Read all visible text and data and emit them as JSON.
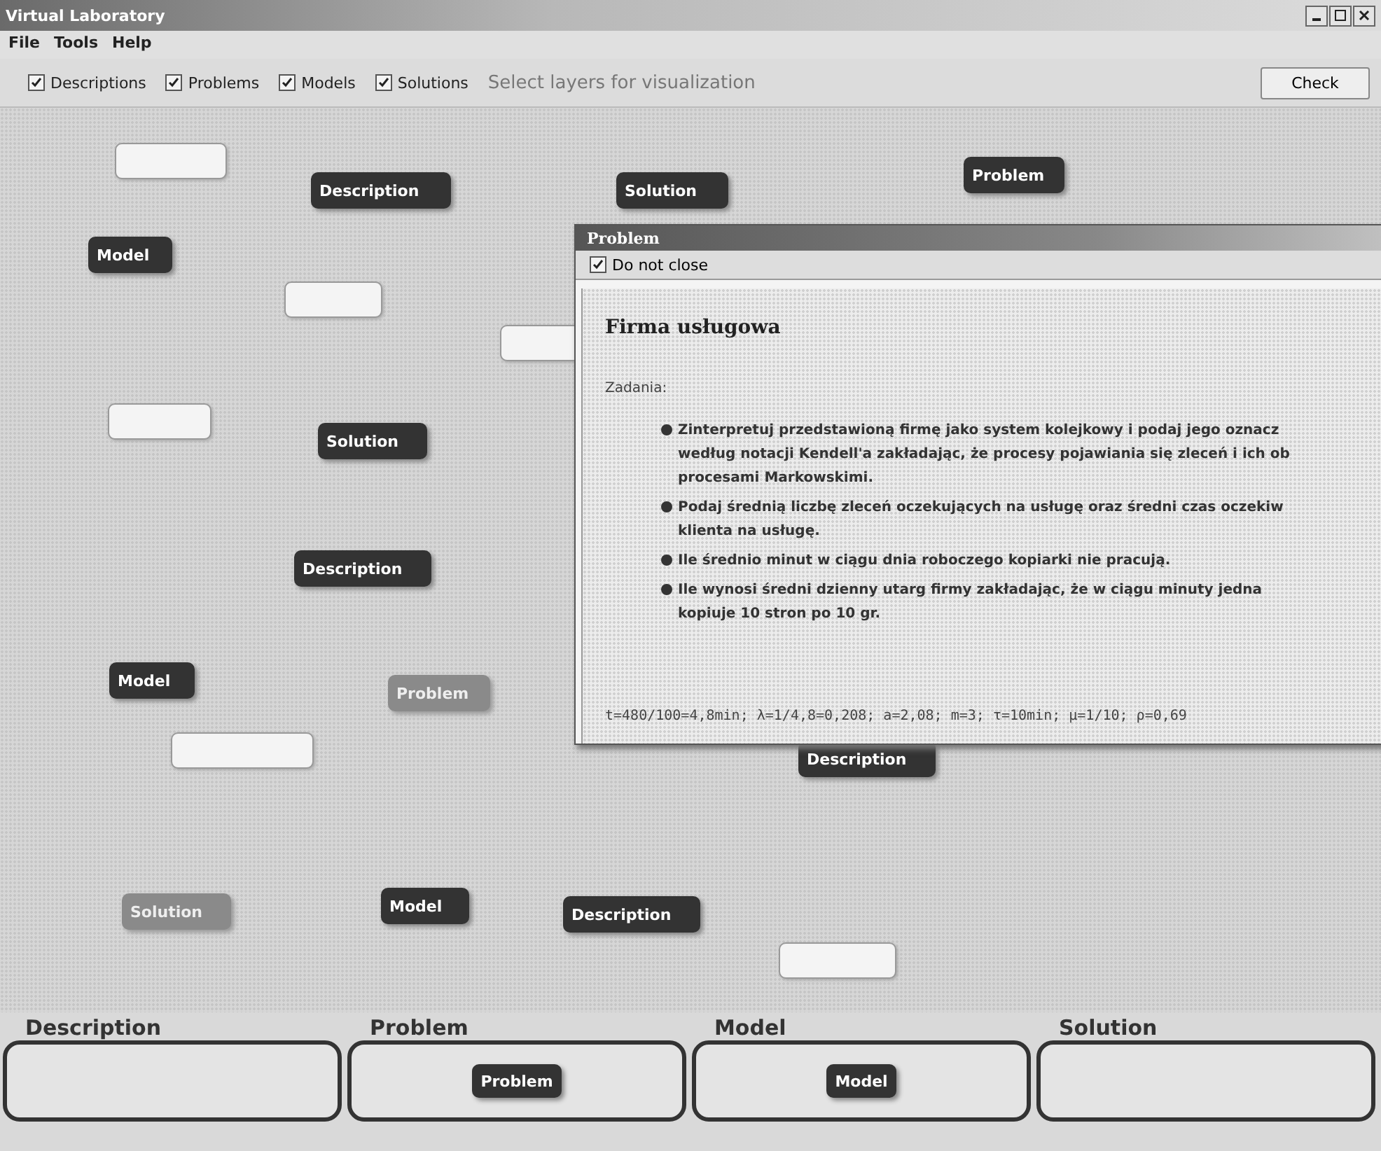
{
  "window": {
    "title": "Virtual Laboratory"
  },
  "menu": [
    "File",
    "Tools",
    "Help"
  ],
  "toolbar": {
    "layers": [
      {
        "label": "Descriptions",
        "checked": true
      },
      {
        "label": "Problems",
        "checked": true
      },
      {
        "label": "Models",
        "checked": true
      },
      {
        "label": "Solutions",
        "checked": true
      }
    ],
    "hint": "Select layers for visualization",
    "button": "Check"
  },
  "canvas": {
    "nodes": [
      {
        "kind": "light"
      },
      {
        "kind": "dark",
        "label": "Description"
      },
      {
        "kind": "dark",
        "label": "Solution"
      },
      {
        "kind": "dark",
        "label": "Problem"
      },
      {
        "kind": "dark",
        "label": "Model"
      },
      {
        "kind": "light"
      },
      {
        "kind": "light"
      },
      {
        "kind": "light"
      },
      {
        "kind": "dark",
        "label": "Solution"
      },
      {
        "kind": "dark",
        "label": "Description"
      },
      {
        "kind": "dark",
        "label": "Model"
      },
      {
        "kind": "mid",
        "label": "Problem"
      },
      {
        "kind": "light"
      },
      {
        "kind": "dark",
        "label": "Description"
      },
      {
        "kind": "mid",
        "label": "Solution"
      },
      {
        "kind": "dark",
        "label": "Model"
      },
      {
        "kind": "dark",
        "label": "Description"
      },
      {
        "kind": "light"
      }
    ],
    "dialog": {
      "title": "Problem",
      "do_not_close": {
        "label": "Do not close",
        "checked": true
      },
      "heading": "Firma usługowa",
      "section": "Zadania:",
      "tasks": [
        {
          "lines": [
            "Zinterpretuj przedstawioną firmę jako system kolejkowy i podaj jego oznacz",
            "według notacji Kendell'a zakładając, że procesy pojawiania się zleceń i ich ob",
            "procesami Markowskimi."
          ]
        },
        {
          "lines": [
            "Podaj średnią liczbę zleceń oczekujących na usługę oraz średni czas oczekiw",
            "klienta na usługę."
          ]
        },
        {
          "lines": [
            "Ile średnio minut w ciągu dnia roboczego kopiarki nie pracują."
          ]
        },
        {
          "lines": [
            "Ile wynosi średni dzienny utarg firmy zakładając, że w ciągu minuty jedna",
            "kopiuje 10 stron po 10 gr."
          ]
        }
      ],
      "formula": "t=480/100=4,8min; λ=1/4,8=0,208; a=2,08; m=3; τ=10min; μ=1/10; ρ=0,69"
    }
  },
  "slots": [
    {
      "heading": "Description"
    },
    {
      "heading": "Problem",
      "node": {
        "kind": "dark",
        "label": "Problem"
      }
    },
    {
      "heading": "Model",
      "node": {
        "kind": "dark",
        "label": "Model"
      }
    },
    {
      "heading": "Solution"
    }
  ]
}
